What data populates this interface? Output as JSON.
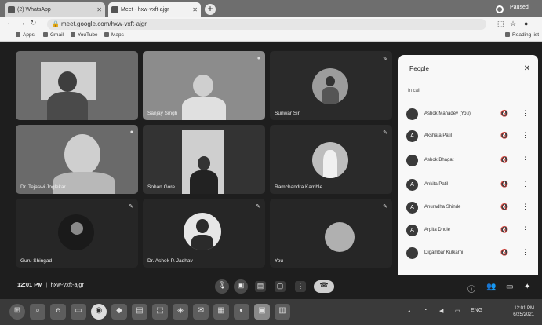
{
  "browser": {
    "tabs": [
      {
        "label": "(2) WhatsApp",
        "active": false
      },
      {
        "label": "Meet - hxw-vxft-ajgr",
        "active": true
      }
    ],
    "new_tab_label": "+",
    "url": "meet.google.com/hxw-vxft-ajgr",
    "window_title": "Paused",
    "bookmarks": [
      "Apps",
      "Gmail",
      "YouTube",
      "Maps"
    ],
    "reading_list": "Reading list"
  },
  "meeting": {
    "code_time": "12:01 PM",
    "separator": "|",
    "code": "hxw-vxft-ajgr",
    "tiles": [
      {
        "name": ""
      },
      {
        "name": "Sanjay Singh"
      },
      {
        "name": "Sunwar Sir"
      },
      {
        "name": "Dr. Tejaswi Joglekar"
      },
      {
        "name": "Sohan Gore"
      },
      {
        "name": "Ramchandra Kamble"
      },
      {
        "name": "Guru Shingad"
      },
      {
        "name": "Dr. Ashok P. Jadhav"
      },
      {
        "name": "You"
      }
    ]
  },
  "people_panel": {
    "title": "People",
    "section": "In call",
    "participants": [
      {
        "initial": "",
        "name": "Ashok Mahadev (You)"
      },
      {
        "initial": "A",
        "name": "Akshata Patil"
      },
      {
        "initial": "",
        "name": "Ashok Bhagat"
      },
      {
        "initial": "A",
        "name": "Ankita Patil"
      },
      {
        "initial": "A",
        "name": "Anuradha Shinde"
      },
      {
        "initial": "A",
        "name": "Arpita Dhole"
      },
      {
        "initial": "",
        "name": "Digambar Kulkarni"
      }
    ]
  },
  "taskbar": {
    "time": "12:01 PM",
    "date": "6/25/2021",
    "lang": "ENG"
  }
}
